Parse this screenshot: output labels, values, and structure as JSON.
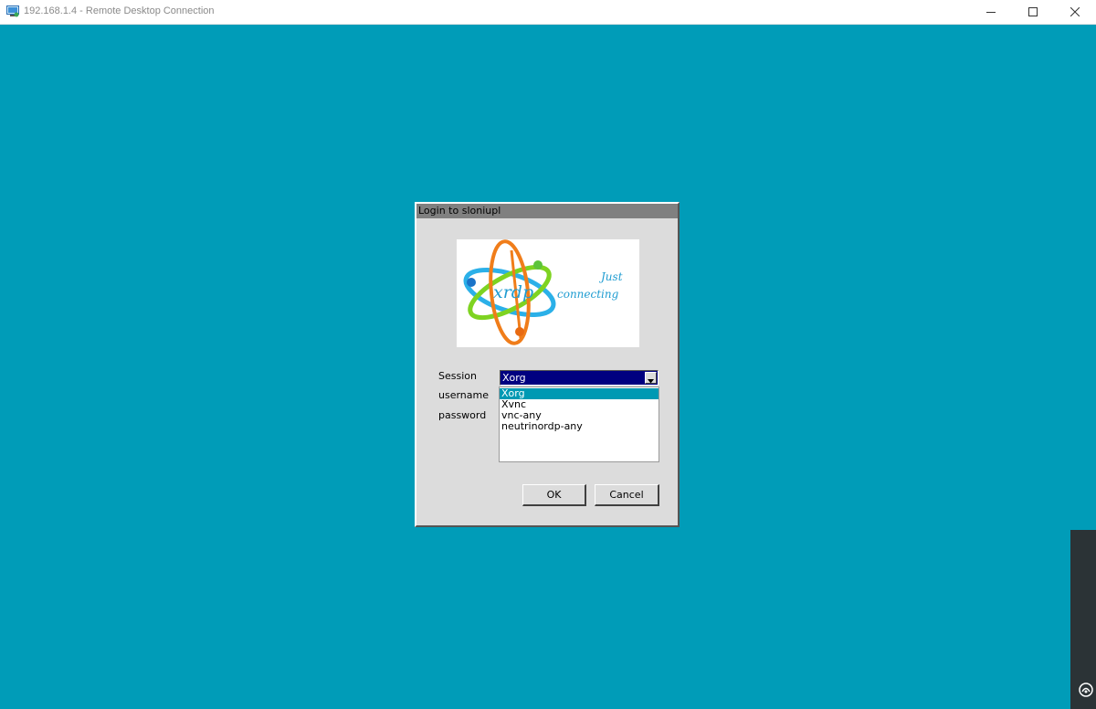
{
  "window": {
    "title": "192.168.1.4 - Remote Desktop Connection"
  },
  "dialog": {
    "title": "Login to sloniupl",
    "logo": {
      "brand": "xrdp",
      "tagline_1": "Just",
      "tagline_2": "connecting"
    },
    "labels": {
      "session": "Session",
      "username": "username",
      "password": "password"
    },
    "session_combo": {
      "selected": "Xorg",
      "options": [
        "Xorg",
        "Xvnc",
        "vnc-any",
        "neutrinordp-any"
      ],
      "highlighted_option": "Xorg"
    },
    "buttons": {
      "ok": "OK",
      "cancel": "Cancel"
    }
  },
  "colors": {
    "desktop": "#009cb8",
    "dialog_bg": "#dcdcdc",
    "dialog_title_bg": "#808080",
    "combo_selected_bg": "#000080",
    "option_highlight": "#0099b3"
  }
}
